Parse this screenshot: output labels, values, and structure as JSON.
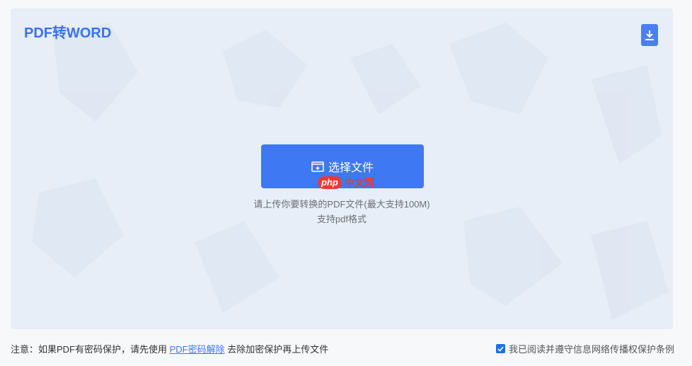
{
  "app": {
    "title": "PDF转WORD"
  },
  "upload": {
    "button_label": "选择文件",
    "hint_primary": "请上传你要转换的PDF文件(最大支持100M)",
    "hint_secondary": "支持pdf格式"
  },
  "watermark": {
    "badge": "php",
    "text": "中文网"
  },
  "footer": {
    "notice_prefix": "注意：如果PDF有密码保护，请先使用 ",
    "notice_link": "PDF密码解除",
    "notice_suffix": " 去除加密保护再上传文件",
    "agreement_label": "我已阅读并遵守信息网络传播权保护条例",
    "agreement_checked": true
  },
  "colors": {
    "accent": "#3f78f3",
    "panel_bg": "#e8eef7",
    "watermark": "#e83b32"
  },
  "icons": {
    "download": "download-icon",
    "folder": "folder-icon",
    "check": "check-icon"
  }
}
